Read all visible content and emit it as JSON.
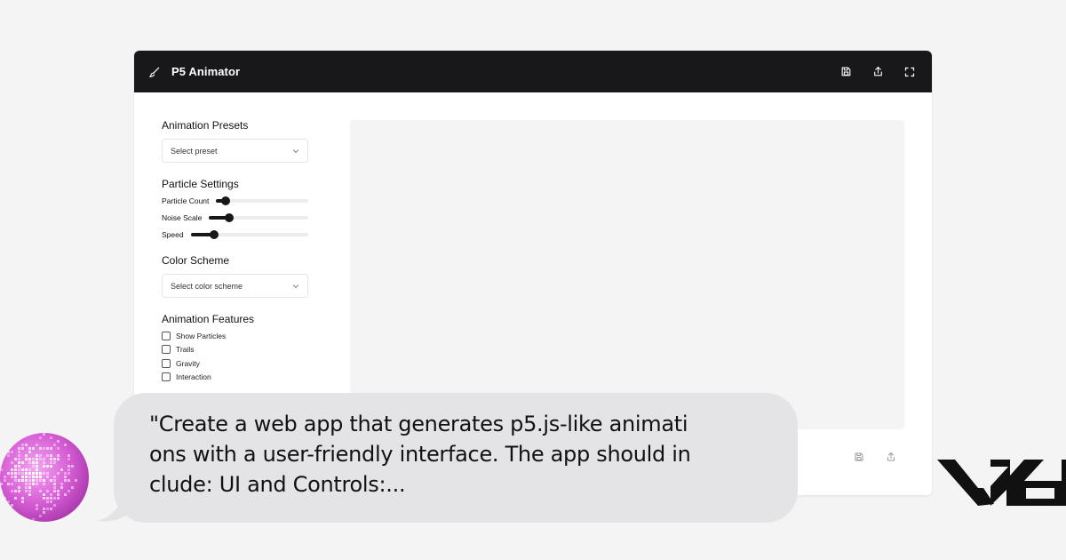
{
  "app": {
    "title": "P5 Animator",
    "icons": {
      "brush": "brush-icon",
      "save": "save-icon",
      "share": "share-icon",
      "fullscreen": "fullscreen-icon"
    }
  },
  "sidebar": {
    "presets": {
      "heading": "Animation Presets",
      "placeholder": "Select preset"
    },
    "particle_settings": {
      "heading": "Particle Settings",
      "sliders": [
        {
          "label": "Particle Count",
          "value": 0.1
        },
        {
          "label": "Noise Scale",
          "value": 0.2
        },
        {
          "label": "Speed",
          "value": 0.2
        }
      ]
    },
    "color_scheme": {
      "heading": "Color Scheme",
      "placeholder": "Select color scheme"
    },
    "features": {
      "heading": "Animation Features",
      "items": [
        {
          "label": "Show Particles",
          "checked": false
        },
        {
          "label": "Trails",
          "checked": false
        },
        {
          "label": "Gravity",
          "checked": false
        },
        {
          "label": "Interaction",
          "checked": false
        }
      ]
    }
  },
  "chat": {
    "line1": "\"Create a web app that generates p5.js-like animati",
    "line2": "ons with a user-friendly interface. The app should in",
    "line3": "clude: UI and Controls:..."
  },
  "colors": {
    "titlebar": "#18181b",
    "bubble": "#e4e4e7",
    "avatar": "#d75fd6"
  }
}
